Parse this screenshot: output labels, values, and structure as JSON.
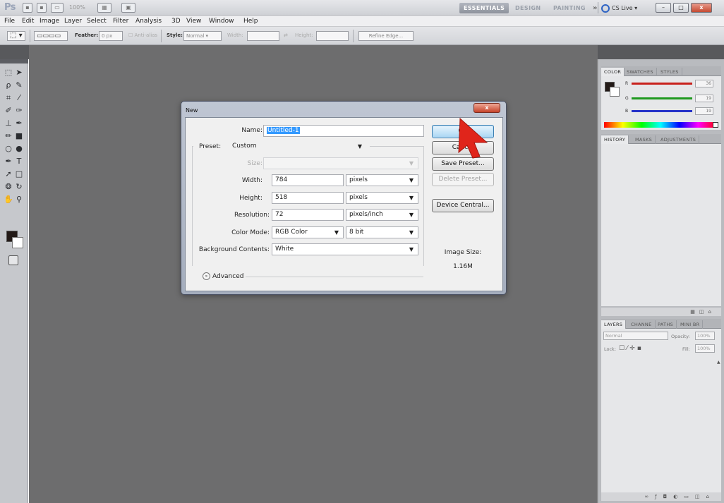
{
  "app": {
    "logo": "Ps",
    "zoom": "100%",
    "workspaces": [
      "ESSENTIALS",
      "DESIGN",
      "PAINTING"
    ],
    "more_workspaces": "»",
    "cs_live": "CS Live",
    "window_controls": {
      "minimize": "–",
      "restore": "□",
      "close": "x"
    }
  },
  "menu": [
    "File",
    "Edit",
    "Image",
    "Layer",
    "Select",
    "Filter",
    "Analysis",
    "3D",
    "View",
    "Window",
    "Help"
  ],
  "options": {
    "feather_label": "Feather:",
    "feather_value": "0 px",
    "antialias_label": "Anti-alias",
    "style_label": "Style:",
    "style_value": "Normal",
    "width_label": "Width:",
    "height_label": "Height:",
    "refine_edge": "Refine Edge..."
  },
  "panels": {
    "color_tabs": [
      "COLOR",
      "SWATCHES",
      "STYLES"
    ],
    "rgb": [
      {
        "letter": "R",
        "value": "36",
        "color": "#c8211c"
      },
      {
        "letter": "G",
        "value": "19",
        "color": "#1f9a1f"
      },
      {
        "letter": "B",
        "value": "19",
        "color": "#2532c9"
      }
    ],
    "history_tabs": [
      "HISTORY",
      "MASKS",
      "ADJUSTMENTS"
    ],
    "layers_tabs": [
      "LAYERS",
      "CHANNE",
      "PATHS",
      "MINI BR"
    ],
    "blend_mode": "Normal",
    "opacity_label": "Opacity:",
    "opacity_value": "100%",
    "lock_label": "Lock:",
    "fill_label": "Fill:",
    "fill_value": "100%"
  },
  "dialog": {
    "title": "New",
    "close": "x",
    "name_label": "Name:",
    "name_value": "Untitled-1",
    "preset_label": "Preset:",
    "preset_value": "Custom",
    "size_label": "Size:",
    "width_label": "Width:",
    "width_value": "784",
    "width_unit": "pixels",
    "height_label": "Height:",
    "height_value": "518",
    "height_unit": "pixels",
    "resolution_label": "Resolution:",
    "resolution_value": "72",
    "resolution_unit": "pixels/inch",
    "color_mode_label": "Color Mode:",
    "color_mode_value": "RGB Color",
    "bit_depth": "8 bit",
    "background_label": "Background Contents:",
    "background_value": "White",
    "advanced_label": "Advanced",
    "buttons": {
      "ok": "OK",
      "cancel": "Cancel",
      "save_preset": "Save Preset...",
      "delete_preset": "Delete Preset...",
      "device_central": "Device Central..."
    },
    "image_size_label": "Image Size:",
    "image_size_value": "1.16M"
  }
}
